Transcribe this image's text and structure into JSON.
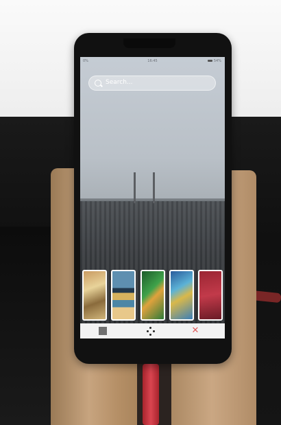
{
  "status_bar": {
    "signal": "0%",
    "time": "16:45",
    "battery": "54%"
  },
  "search": {
    "placeholder": "Search..."
  },
  "wallpaper_picker": {
    "thumbnails": [
      "thumb-sunset",
      "thumb-beach",
      "thumb-leaves",
      "thumb-abstract-blue",
      "thumb-red"
    ]
  },
  "toolbar": {
    "close_glyph": "✕"
  },
  "colors": {
    "accent_close": "#e05a5a",
    "screen_bg": "#c7cdd4"
  }
}
